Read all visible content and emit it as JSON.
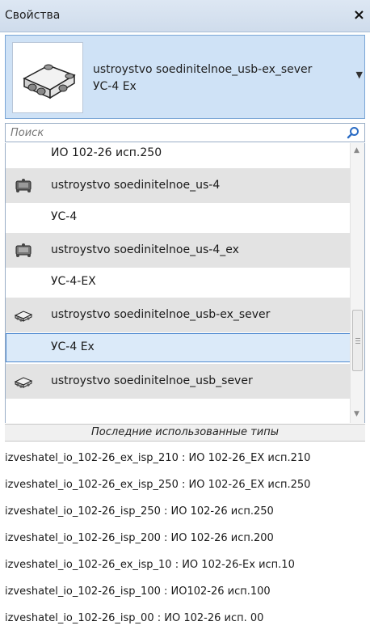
{
  "titlebar": {
    "title": "Свойства",
    "close": "×"
  },
  "type_selector": {
    "family": "ustroystvo soedinitelnoe_usb-ex_sever",
    "type": "УС-4 Ex"
  },
  "search": {
    "placeholder": "Поиск",
    "value": ""
  },
  "list": [
    {
      "kind": "inst",
      "label": "ИО 102-26 исп.250"
    },
    {
      "kind": "type",
      "label": "ustroystvo soedinitelnoe_us-4",
      "icon": "us4-device-icon"
    },
    {
      "kind": "inst",
      "label": "УС-4"
    },
    {
      "kind": "type",
      "label": "ustroystvo soedinitelnoe_us-4_ex",
      "icon": "us4ex-device-icon"
    },
    {
      "kind": "inst",
      "label": "УС-4-EX"
    },
    {
      "kind": "type",
      "label": "ustroystvo soedinitelnoe_usb-ex_sever",
      "icon": "usbex-device-icon"
    },
    {
      "kind": "inst",
      "label": "УС-4 Ex",
      "selected": true
    },
    {
      "kind": "type",
      "label": "ustroystvo soedinitelnoe_usb_sever",
      "icon": "usb-device-icon"
    }
  ],
  "recent": {
    "header": "Последние использованные типы",
    "items": [
      "izveshatel_io_102-26_ex_isp_210 : ИО 102-26_EX исп.210",
      "izveshatel_io_102-26_ex_isp_250 : ИО 102-26_EX исп.250",
      "izveshatel_io_102-26_isp_250 : ИО 102-26 исп.250",
      "izveshatel_io_102-26_isp_200 : ИО 102-26 исп.200",
      "izveshatel_io_102-26_ex_isp_10 : ИО 102-26-Ex исп.10",
      "izveshatel_io_102-26_isp_100 : ИО102-26 исп.100",
      "izveshatel_io_102-26_isp_00 : ИО 102-26 исп. 00"
    ]
  }
}
